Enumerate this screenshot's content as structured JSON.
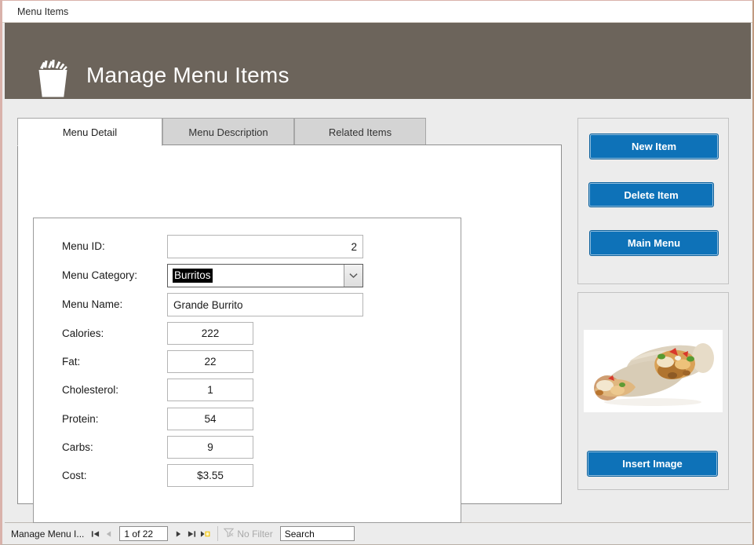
{
  "window": {
    "document_tab": "Menu Items"
  },
  "header": {
    "title": "Manage Menu Items",
    "icon": "french-fries-icon",
    "background_color": "#6c645b"
  },
  "tabs": [
    {
      "label": "Menu Detail",
      "active": true
    },
    {
      "label": "Menu Description",
      "active": false
    },
    {
      "label": "Related Items",
      "active": false
    }
  ],
  "form": {
    "fields": [
      {
        "label": "Menu ID:",
        "value": "2",
        "type": "text",
        "align": "right"
      },
      {
        "label": "Menu Category:",
        "value": "Burritos",
        "type": "combobox",
        "selected": true
      },
      {
        "label": "Menu Name:",
        "value": "Grande Burrito",
        "type": "text",
        "align": "left"
      },
      {
        "label": "Calories:",
        "value": "222",
        "type": "number"
      },
      {
        "label": "Fat:",
        "value": "22",
        "type": "number"
      },
      {
        "label": "Cholesterol:",
        "value": "1",
        "type": "number"
      },
      {
        "label": "Protein:",
        "value": "54",
        "type": "number"
      },
      {
        "label": "Carbs:",
        "value": "9",
        "type": "number"
      },
      {
        "label": "Cost:",
        "value": "$3.55",
        "type": "number"
      }
    ]
  },
  "actions": {
    "new_item": "New Item",
    "delete_item": "Delete Item",
    "main_menu": "Main Menu",
    "insert_image": "Insert Image",
    "button_color": "#0e72b8"
  },
  "image_panel": {
    "alt": "burrito-photo"
  },
  "statusbar": {
    "object_name": "Manage Menu I...",
    "record_text": "1 of 22",
    "filter_text": "No Filter",
    "search_text": "Search",
    "nav": {
      "first": "⏮",
      "previous": "◂",
      "next": "▸",
      "last": "⏭",
      "new_record": "▸*"
    }
  }
}
